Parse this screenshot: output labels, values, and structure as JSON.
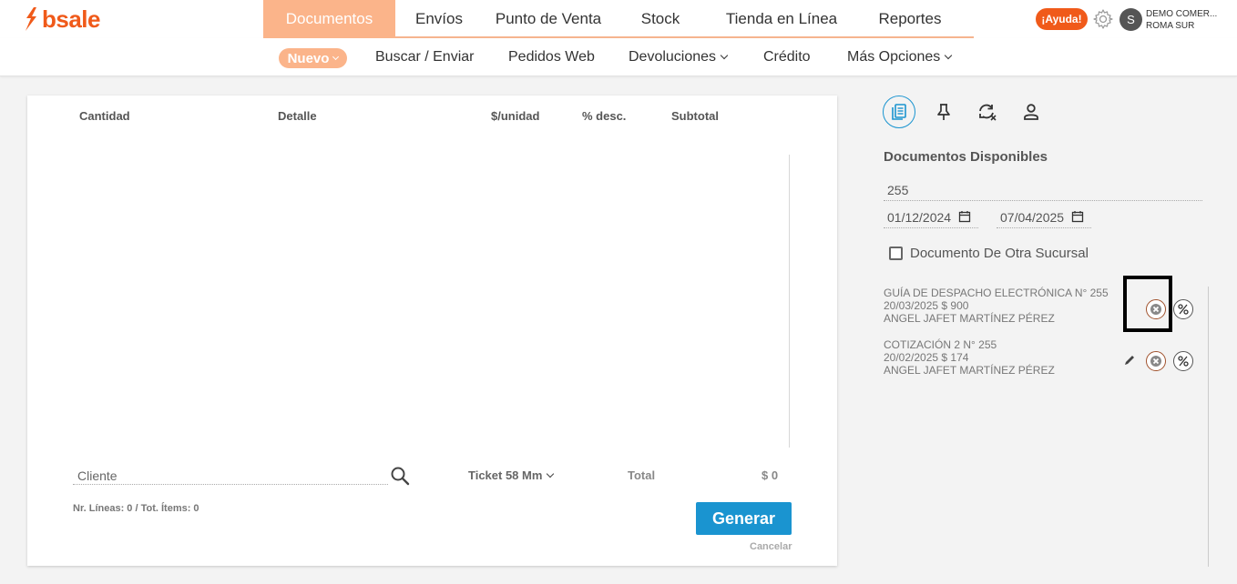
{
  "brand": {
    "name": "bsale",
    "color": "#f05a1a"
  },
  "main_nav": {
    "items": [
      {
        "label": "Documentos",
        "active": true
      },
      {
        "label": "Envíos",
        "active": false
      },
      {
        "label": "Punto de Venta",
        "active": false
      },
      {
        "label": "Stock",
        "active": false
      },
      {
        "label": "Tienda en Línea",
        "active": false
      },
      {
        "label": "Reportes",
        "active": false
      }
    ]
  },
  "header_right": {
    "help_label": "¡Ayuda!",
    "settings_icon": "gear-icon",
    "avatar_letter": "S",
    "company_line1": "DEMO COMER...",
    "company_line2": "ROMA SUR"
  },
  "sub_nav": {
    "nuevo_label": "Nuevo",
    "items": [
      {
        "label": "Buscar / Enviar",
        "dropdown": false
      },
      {
        "label": "Pedidos Web",
        "dropdown": false
      },
      {
        "label": "Devoluciones",
        "dropdown": true
      },
      {
        "label": "Crédito",
        "dropdown": false
      },
      {
        "label": "Más Opciones",
        "dropdown": true
      }
    ]
  },
  "document_table": {
    "columns": [
      "Cantidad",
      "Detalle",
      "$/unidad",
      "% desc.",
      "Subtotal"
    ]
  },
  "document_footer": {
    "client_placeholder": "Cliente",
    "ticket_type": "Ticket 58 Mm",
    "total_label": "Total",
    "total_value": "$ 0",
    "lines_info": "Nr. Líneas: 0 / Tot. Ítems: 0",
    "generate_label": "Generar",
    "cancel_label": "Cancelar"
  },
  "right_panel": {
    "tabs": [
      {
        "icon": "documents-icon",
        "active": true
      },
      {
        "icon": "pin-icon",
        "active": false
      },
      {
        "icon": "sync-icon",
        "active": false
      },
      {
        "icon": "user-icon",
        "active": false
      }
    ],
    "title": "Documentos Disponibles",
    "search_value": "255",
    "date_from": "01/12/2024",
    "date_to": "07/04/2025",
    "other_branch_label": "Documento De Otra Sucursal",
    "other_branch_checked": false,
    "documents": [
      {
        "line1": "GUÍA DE DESPACHO ELECTRÓNICA N° 255",
        "line2": "20/03/2025 $ 900",
        "line3": "ANGEL JAFET MARTÍNEZ PÉREZ",
        "editable": false
      },
      {
        "line1": "COTIZACIÓN 2 N° 255",
        "line2": "20/02/2025 $ 174",
        "line3": "ANGEL JAFET MARTÍNEZ PÉREZ",
        "editable": true
      }
    ]
  },
  "colors": {
    "accent_orange": "#f05a1a",
    "nav_active": "#fbb48a",
    "primary_blue": "#1a94d0"
  }
}
